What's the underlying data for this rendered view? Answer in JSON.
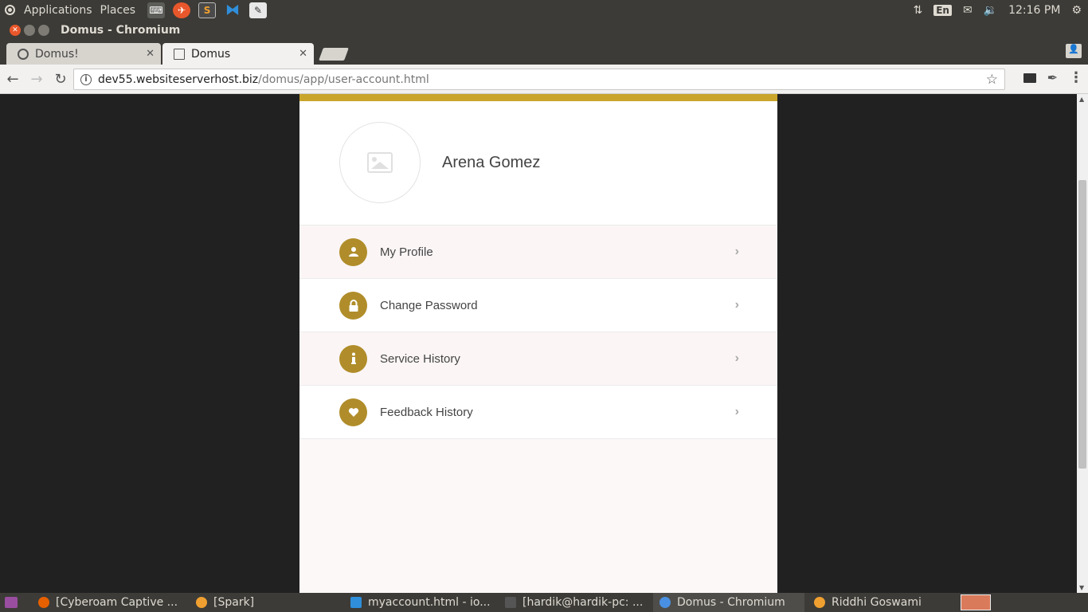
{
  "top_panel": {
    "applications": "Applications",
    "places": "Places",
    "lang": "En",
    "time": "12:16 PM"
  },
  "window": {
    "title": "Domus - Chromium"
  },
  "tabs": [
    {
      "label": "Domus!",
      "active": false
    },
    {
      "label": "Domus",
      "active": true
    }
  ],
  "toolbar": {
    "url_host": "dev55.websiteserverhost.biz",
    "url_path": "/domus/app/user-account.html"
  },
  "page": {
    "user_name": "Arena Gomez",
    "menu": [
      {
        "label": "My Profile",
        "icon": "user-icon"
      },
      {
        "label": "Change Password",
        "icon": "lock-icon"
      },
      {
        "label": "Service History",
        "icon": "info-icon"
      },
      {
        "label": "Feedback History",
        "icon": "heart-icon"
      }
    ],
    "colors": {
      "accent": "#b08d2a",
      "banner": "#c9a52c",
      "panel_bg": "#fcf8f8"
    }
  },
  "taskbar": {
    "items": [
      {
        "label": "[Cyberoam Captive ..."
      },
      {
        "label": "[Spark]"
      },
      {
        "label": "myaccount.html - io..."
      },
      {
        "label": "[hardik@hardik-pc: ..."
      },
      {
        "label": "Domus - Chromium"
      },
      {
        "label": "Riddhi Goswami"
      }
    ]
  }
}
